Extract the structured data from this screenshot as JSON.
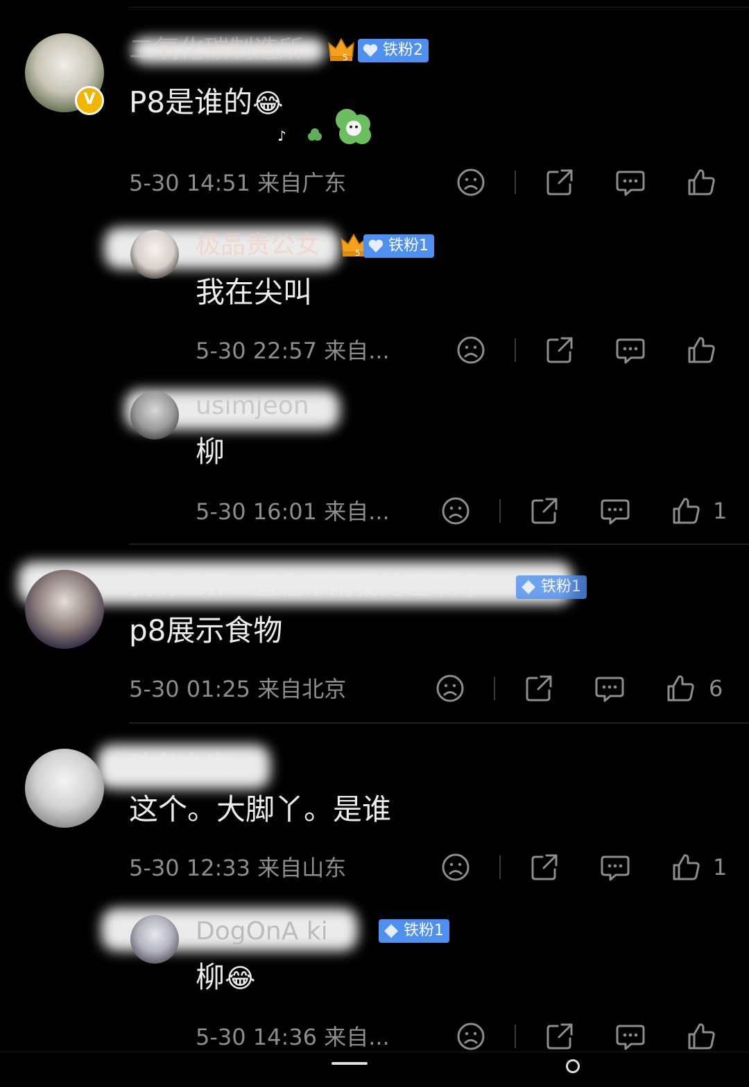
{
  "comments": [
    {
      "user": "二氧化碳制造所",
      "badge": "铁粉2",
      "verified": "V",
      "text": "P8是谁的",
      "emoji": "😂",
      "time": "5-30 14:51",
      "location": "来自广东",
      "likes": "",
      "replies": [
        {
          "user": "极品贵公女",
          "badge": "铁粉1",
          "text": "我在尖叫",
          "time": "5-30 22:57",
          "location": "来自...",
          "likes": ""
        },
        {
          "user": "usimjeon",
          "text": "柳",
          "time": "5-30 16:01",
          "location": "来自...",
          "likes": "1"
        }
      ]
    },
    {
      "user": "我的世界一直在下雨我处理不好",
      "badge": "铁粉1",
      "text": "p8展示食物",
      "time": "5-30 01:25",
      "location": "来自北京",
      "likes": "6"
    },
    {
      "user": "珀冬之痕",
      "text": "这个。大脚丫。是谁",
      "time": "5-30 12:33",
      "location": "来自山东",
      "likes": "1",
      "replies": [
        {
          "user": "DogOnA ki",
          "badge": "铁粉1",
          "text": "柳",
          "emoji": "😂",
          "time": "5-30 14:36",
          "location": "来自...",
          "likes": ""
        }
      ]
    }
  ],
  "icons": {
    "dislike": "sad-face-icon",
    "share": "share-icon",
    "comment": "comment-icon",
    "like": "thumbs-up-icon"
  },
  "colors": {
    "background": "#000000",
    "username": "#d9a28a",
    "badge": "#4f8ff0",
    "meta": "#8e8e8e"
  }
}
